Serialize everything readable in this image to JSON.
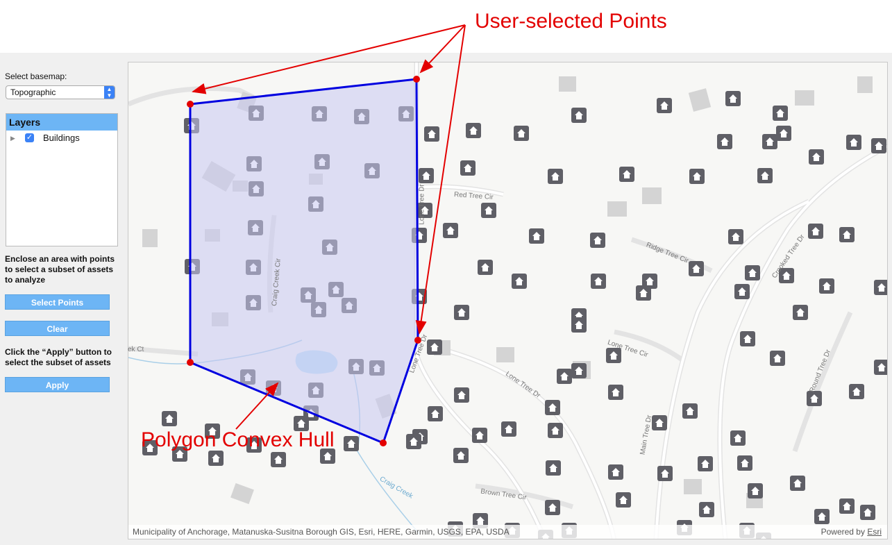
{
  "annotations": {
    "top": "User-selected Points",
    "bottom": "Polygon Convex Hull"
  },
  "sidebar": {
    "basemap_label": "Select basemap:",
    "basemap_value": "Topographic",
    "layers_title": "Layers",
    "layer_name": "Buildings",
    "instruction1": "Enclose an area with points to select a subset of assets to analyze",
    "select_points_label": "Select Points",
    "clear_label": "Clear",
    "instruction2": "Click the “Apply” button to select the subset of assets",
    "apply_label": "Apply"
  },
  "map": {
    "streets": [
      "Red Tree Cir",
      "Lone Tree Dr",
      "Ridge Tree Cir",
      "Crooked Tree Dr",
      "Craig Creek Cir",
      "Lone Tree Cir",
      "Lone Tree Dr",
      "Main Tree Dr",
      "Round Tree Dr",
      "Brown Tree Cir",
      "Craig Creek",
      "ek Ct",
      "Lone Tree Dr"
    ],
    "attribution": "Municipality of Anchorage, Matanuska-Susitna Borough GIS, Esri, HERE, Garmin, USGS, EPA, USDA",
    "powered_by": "Powered by",
    "powered_link": "Esri"
  },
  "colors": {
    "annotation": "#e30000",
    "hull_stroke": "#0000e0",
    "hull_fill": "#c8c8f0",
    "button": "#6db5f5",
    "marker": "#5f5f66"
  }
}
